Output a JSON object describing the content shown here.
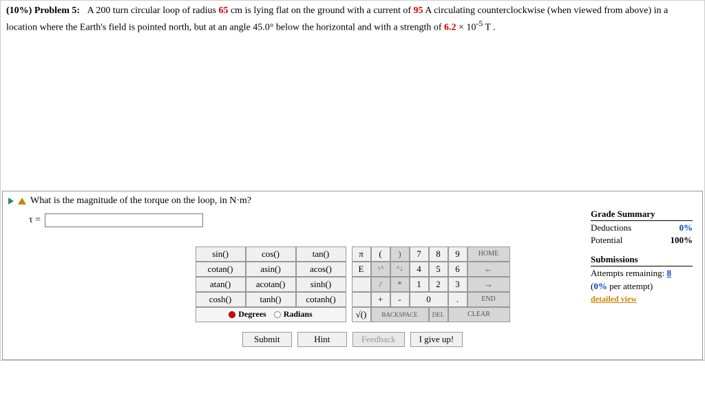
{
  "problem": {
    "weight": "(10%)",
    "label": "Problem 5:",
    "turns": "200",
    "radius": "65",
    "current": "95",
    "angle": "45.0°",
    "field_strength": "6.2",
    "exponent": "-5",
    "text_part1": "A ",
    "text_part2": " turn circular loop of radius ",
    "text_part3": " cm is lying flat on the ground with a current of ",
    "text_part4": " A circulating counterclockwise (when viewed from above) in a location where the Earth's field is pointed north, but at an angle ",
    "text_part5": " below the horizontal and with a strength of ",
    "text_part6": " × 10",
    "text_part7": " T ."
  },
  "question": {
    "text": "What is the magnitude of the torque on the loop, in N·m?",
    "tau": "τ =",
    "input_value": ""
  },
  "funcs": {
    "r0c0": "sin()",
    "r0c1": "cos()",
    "r0c2": "tan()",
    "r1c0": "cotan()",
    "r1c1": "asin()",
    "r1c2": "acos()",
    "r2c0": "atan()",
    "r2c1": "acotan()",
    "r2c2": "sinh()",
    "r3c0": "cosh()",
    "r3c1": "tanh()",
    "r3c2": "cotanh()",
    "degrees": "Degrees",
    "radians": "Radians"
  },
  "keys": {
    "pi": "π",
    "lp": "(",
    "rp": ")",
    "k7": "7",
    "k8": "8",
    "k9": "9",
    "home": "HOME",
    "e": "E",
    "up": "↑^",
    "dn": "^↓",
    "k4": "4",
    "k5": "5",
    "k6": "6",
    "left": "←",
    "sl": "/",
    "st": "*",
    "k1": "1",
    "k2": "2",
    "k3": "3",
    "right": "→",
    "pl": "+",
    "mi": "-",
    "k0": "0",
    "dot": ".",
    "end": "END",
    "sq": "√()",
    "bs": "BACKSPACE",
    "del": "DEL",
    "clr": "CLEAR"
  },
  "actions": {
    "submit": "Submit",
    "hint": "Hint",
    "feedback": "Feedback",
    "giveup": "I give up!"
  },
  "grade": {
    "title": "Grade Summary",
    "ded_label": "Deductions",
    "ded_val": "0%",
    "pot_label": "Potential",
    "pot_val": "100%",
    "sub_title": "Submissions",
    "attempts_label": "Attempts remaining: ",
    "attempts_val": "8",
    "penalty_pct": "0%",
    "penalty_suffix": " per attempt)",
    "detailed": "detailed view"
  }
}
